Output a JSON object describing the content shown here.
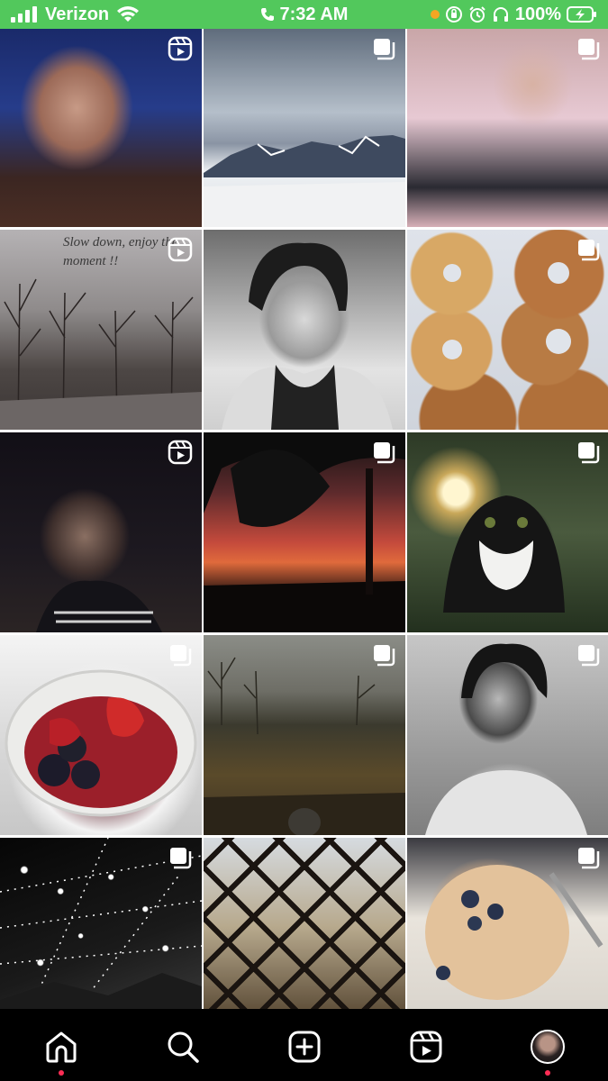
{
  "status_bar": {
    "carrier": "Verizon",
    "time": "7:32 AM",
    "battery": "100%",
    "background_color": "#52c85c",
    "icons": [
      "signal-bars-icon",
      "wifi-icon",
      "phone-call-icon",
      "orientation-lock-icon",
      "alarm-icon",
      "headphones-icon",
      "battery-charging-icon"
    ]
  },
  "grid": {
    "tiles": [
      {
        "badge": "reels-icon",
        "subject": "portrait"
      },
      {
        "badge": "multiple-photos-icon",
        "subject": "snowy mountains"
      },
      {
        "badge": "multiple-photos-icon",
        "subject": "portrait"
      },
      {
        "badge": "reels-icon",
        "subject": "bare trees",
        "overlay_text": "Slow down, enjoy the moment !!"
      },
      {
        "badge": "",
        "subject": "portrait"
      },
      {
        "badge": "multiple-photos-icon",
        "subject": "donuts"
      },
      {
        "badge": "reels-icon",
        "subject": "portrait"
      },
      {
        "badge": "multiple-photos-icon",
        "subject": "sunset"
      },
      {
        "badge": "multiple-photos-icon",
        "subject": "cat"
      },
      {
        "badge": "multiple-photos-icon",
        "subject": "berries"
      },
      {
        "badge": "multiple-photos-icon",
        "subject": "autumn forest"
      },
      {
        "badge": "multiple-photos-icon",
        "subject": "portrait"
      },
      {
        "badge": "multiple-photos-icon",
        "subject": "city lights"
      },
      {
        "badge": "",
        "subject": "lattice window"
      },
      {
        "badge": "multiple-photos-icon",
        "subject": "blueberry pastry"
      }
    ]
  },
  "bottom_nav": {
    "items": [
      {
        "name": "home",
        "icon": "home-icon",
        "active": true
      },
      {
        "name": "search",
        "icon": "search-icon",
        "active": false
      },
      {
        "name": "create",
        "icon": "plus-square-icon",
        "active": false
      },
      {
        "name": "reels",
        "icon": "reels-icon",
        "active": false
      },
      {
        "name": "profile",
        "icon": "avatar",
        "active": false,
        "notification": true
      }
    ],
    "dot_color": "#ff2d55"
  }
}
